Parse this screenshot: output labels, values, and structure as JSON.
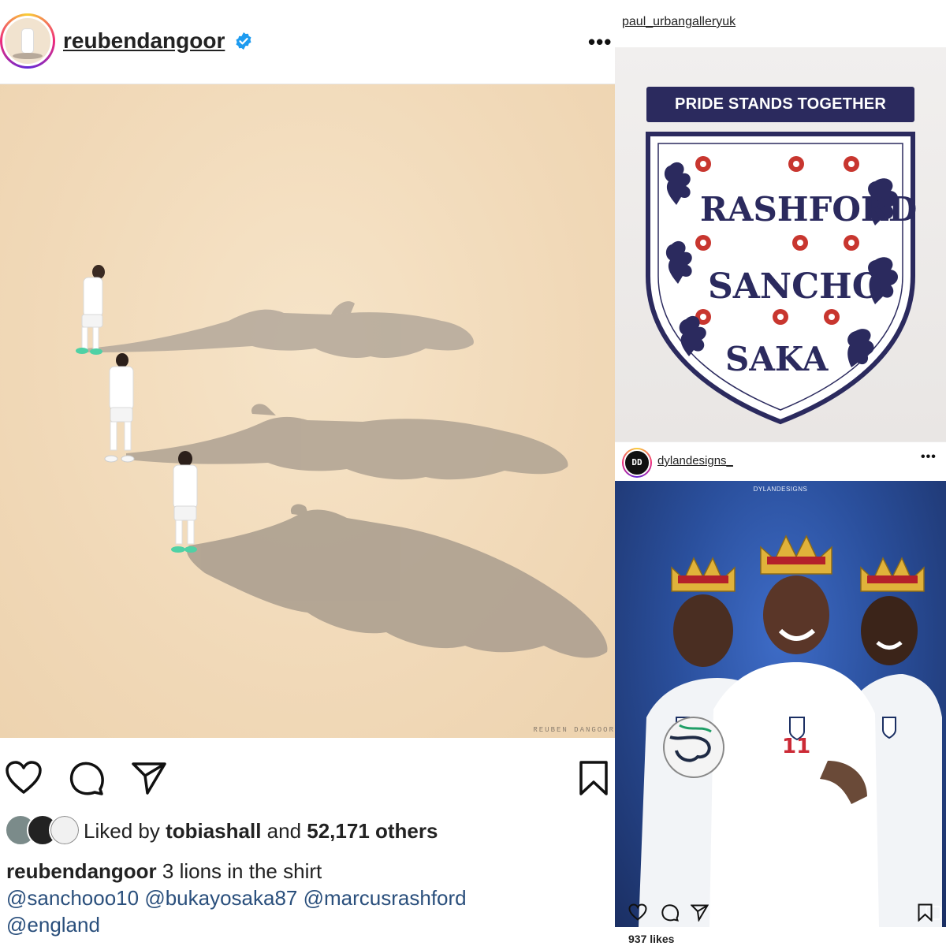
{
  "left_post": {
    "username": "reubendangoor",
    "artwork_signature": "REUBEN DANGOOR",
    "liked_by_prefix": "Liked by ",
    "liked_by_user": "tobiashall",
    "liked_by_middle": " and ",
    "liked_by_count": "52,171 others",
    "caption_user": "reubendangoor",
    "caption_text": " 3 lions in the shirt",
    "caption_tags": [
      "@sanchooo10",
      "@bukayosaka87",
      "@marcusrashford",
      "@england"
    ],
    "icons": [
      "heart-icon",
      "comment-icon",
      "share-icon",
      "bookmark-icon",
      "more-icon",
      "verified-icon"
    ]
  },
  "crest_post": {
    "username": "paul_urbangalleryuk",
    "banner": "PRIDE STANDS TOGETHER",
    "names": [
      "RASHFORD",
      "SANCHO",
      "SAKA"
    ],
    "colors": {
      "navy": "#2b2a5e",
      "red": "#c8362f"
    }
  },
  "dylan_post": {
    "username": "dylandesigns_",
    "avatar_text": "DD",
    "watermark": "DYLANDESIGNS",
    "likes": "937 likes",
    "colors": {
      "background": "#2a4f9c",
      "crown": "#e0b23a"
    }
  }
}
